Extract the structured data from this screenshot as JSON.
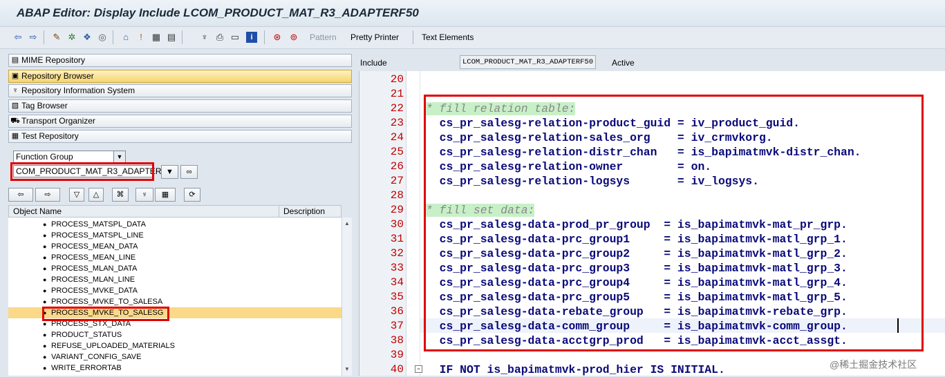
{
  "window": {
    "title": "ABAP Editor: Display Include LCOM_PRODUCT_MAT_R3_ADAPTERF50"
  },
  "toolbar": {
    "pattern_label": "Pattern",
    "pretty_printer_label": "Pretty Printer",
    "text_elements_label": "Text Elements"
  },
  "nav": {
    "items": [
      {
        "label": "MIME Repository"
      },
      {
        "label": "Repository Browser"
      },
      {
        "label": "Repository Information System"
      },
      {
        "label": "Tag Browser"
      },
      {
        "label": "Transport Organizer"
      },
      {
        "label": "Test Repository"
      }
    ],
    "selected_index": 1
  },
  "object_selector": {
    "type_value": "Function Group",
    "name_value": "COM_PRODUCT_MAT_R3_ADAPTER"
  },
  "tree": {
    "columns": [
      "Object Name",
      "Description"
    ],
    "rows": [
      "PROCESS_MATSPL_DATA",
      "PROCESS_MATSPL_LINE",
      "PROCESS_MEAN_DATA",
      "PROCESS_MEAN_LINE",
      "PROCESS_MLAN_DATA",
      "PROCESS_MLAN_LINE",
      "PROCESS_MVKE_DATA",
      "PROCESS_MVKE_TO_SALESA",
      "PROCESS_MVKE_TO_SALESG",
      "PROCESS_STX_DATA",
      "PRODUCT_STATUS",
      "REFUSE_UPLOADED_MATERIALS",
      "VARIANT_CONFIG_SAVE",
      "WRITE_ERRORTAB"
    ],
    "selected_row": "PROCESS_MVKE_TO_SALESG"
  },
  "editor": {
    "include_label": "Include",
    "include_name": "LCOM_PRODUCT_MAT_R3_ADAPTERF50",
    "status": "Active",
    "lines": [
      {
        "num": "20",
        "text": ""
      },
      {
        "num": "21",
        "text": ""
      },
      {
        "num": "22",
        "text": "* fill relation table:",
        "comment": true
      },
      {
        "num": "23",
        "text": "  cs_pr_salesg-relation-product_guid = iv_product_guid."
      },
      {
        "num": "24",
        "text": "  cs_pr_salesg-relation-sales_org    = iv_crmvkorg."
      },
      {
        "num": "25",
        "text": "  cs_pr_salesg-relation-distr_chan   = is_bapimatmvk-distr_chan."
      },
      {
        "num": "26",
        "text": "  cs_pr_salesg-relation-owner        = on."
      },
      {
        "num": "27",
        "text": "  cs_pr_salesg-relation-logsys       = iv_logsys."
      },
      {
        "num": "28",
        "text": ""
      },
      {
        "num": "29",
        "text": "* fill set data:",
        "comment": true
      },
      {
        "num": "30",
        "text": "  cs_pr_salesg-data-prod_pr_group  = is_bapimatmvk-mat_pr_grp."
      },
      {
        "num": "31",
        "text": "  cs_pr_salesg-data-prc_group1     = is_bapimatmvk-matl_grp_1."
      },
      {
        "num": "32",
        "text": "  cs_pr_salesg-data-prc_group2     = is_bapimatmvk-matl_grp_2."
      },
      {
        "num": "33",
        "text": "  cs_pr_salesg-data-prc_group3     = is_bapimatmvk-matl_grp_3."
      },
      {
        "num": "34",
        "text": "  cs_pr_salesg-data-prc_group4     = is_bapimatmvk-matl_grp_4."
      },
      {
        "num": "35",
        "text": "  cs_pr_salesg-data-prc_group5     = is_bapimatmvk-matl_grp_5."
      },
      {
        "num": "36",
        "text": "  cs_pr_salesg-data-rebate_group   = is_bapimatmvk-rebate_grp."
      },
      {
        "num": "37",
        "text": "  cs_pr_salesg-data-comm_group     = is_bapimatmvk-comm_group."
      },
      {
        "num": "38",
        "text": "  cs_pr_salesg-data-acctgrp_prod   = is_bapimatmvk-acct_assgt."
      },
      {
        "num": "39",
        "text": ""
      },
      {
        "num": "40",
        "text": "  IF NOT is_bapimatmvk-prod_hier IS INITIAL."
      }
    ]
  },
  "watermark": "@稀土掘金技术社区"
}
